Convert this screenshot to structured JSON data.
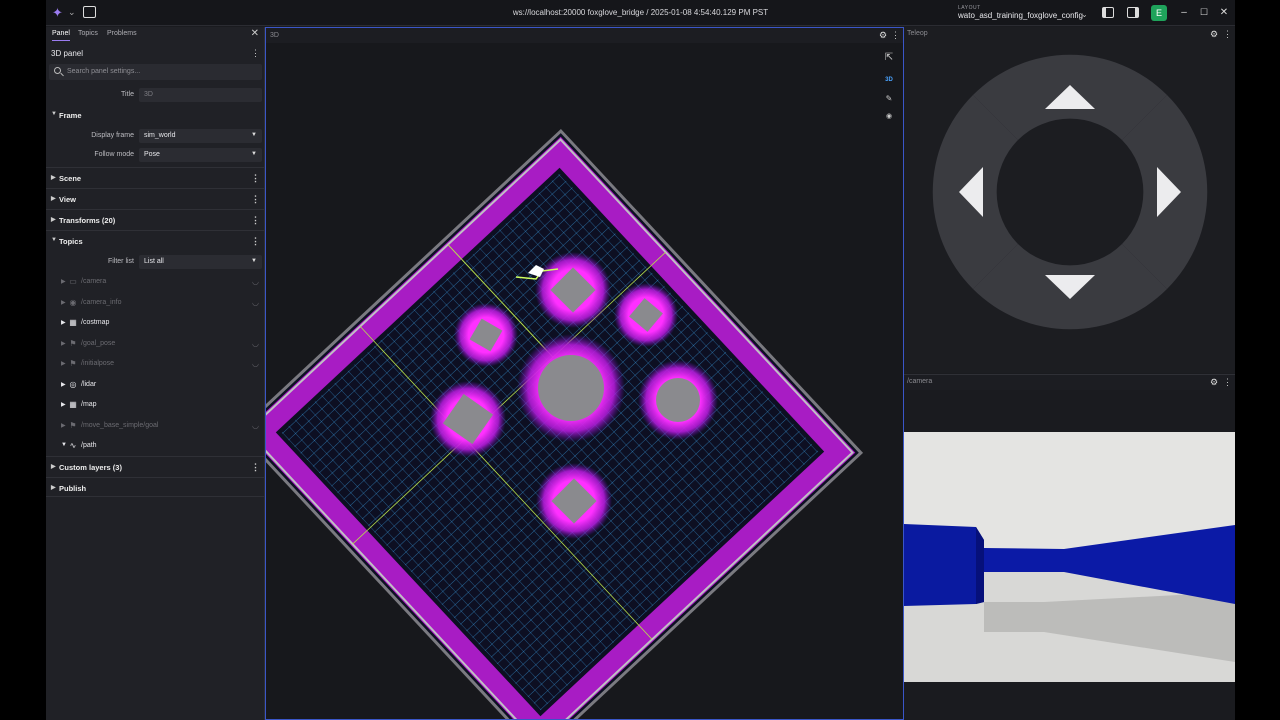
{
  "titlebar": {
    "connection": "ws://localhost:20000 foxglove_bridge / 2025-01-08 4:54:40.129 PM PST",
    "layout_label": "LAYOUT",
    "layout_name": "wato_asd_training_foxglove_config",
    "avatar_letter": "E"
  },
  "sidebar": {
    "tabs": [
      "Panel",
      "Topics",
      "Problems"
    ],
    "panel_title": "3D panel",
    "search_placeholder": "Search panel settings...",
    "title_label": "Title",
    "title_placeholder": "3D",
    "frame_section": "Frame",
    "display_frame_label": "Display frame",
    "display_frame_value": "sim_world",
    "follow_mode_label": "Follow mode",
    "follow_mode_value": "Pose",
    "sections": [
      "Scene",
      "View",
      "Transforms (20)"
    ],
    "topics_section": "Topics",
    "filter_label": "Filter list",
    "filter_value": "List all",
    "topics": [
      {
        "name": "/camera",
        "icon": "image-icon",
        "enabled": false
      },
      {
        "name": "/camera_info",
        "icon": "camera-icon",
        "enabled": false
      },
      {
        "name": "/costmap",
        "icon": "grid-icon",
        "enabled": true
      },
      {
        "name": "/goal_pose",
        "icon": "flag-icon",
        "enabled": false
      },
      {
        "name": "/initialpose",
        "icon": "flag-icon",
        "enabled": false
      },
      {
        "name": "/lidar",
        "icon": "lidar-icon",
        "enabled": true
      },
      {
        "name": "/map",
        "icon": "grid-icon",
        "enabled": true
      },
      {
        "name": "/move_base_simple/goal",
        "icon": "flag-icon",
        "enabled": false
      },
      {
        "name": "/path",
        "icon": "path-icon",
        "enabled": true
      }
    ],
    "custom_layers": "Custom layers (3)",
    "publish": "Publish"
  },
  "panel3d": {
    "title": "3D",
    "mode_badge": "3D"
  },
  "teleop": {
    "title": "Teleop"
  },
  "camera": {
    "title": "/camera"
  },
  "colors": {
    "accent": "#9b7cf0",
    "costmap_magenta": "#d21ee6",
    "grid_blue": "#3aa0e6",
    "camera_blue": "#0a1a9e"
  }
}
